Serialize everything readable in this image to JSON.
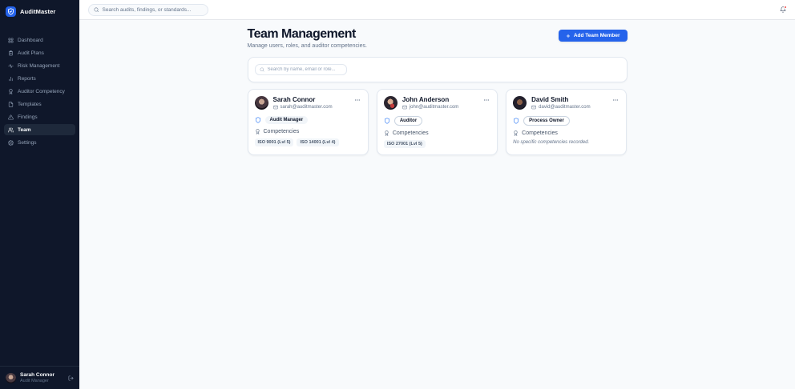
{
  "app": {
    "name": "AuditMaster"
  },
  "sidebar": {
    "items": [
      {
        "label": "Dashboard",
        "icon": "dashboard-icon",
        "active": false
      },
      {
        "label": "Audit Plans",
        "icon": "audit-plans-icon",
        "active": false
      },
      {
        "label": "Risk Management",
        "icon": "risk-management-icon",
        "active": false
      },
      {
        "label": "Reports",
        "icon": "reports-icon",
        "active": false
      },
      {
        "label": "Auditor Competency",
        "icon": "auditor-competency-icon",
        "active": false
      },
      {
        "label": "Templates",
        "icon": "templates-icon",
        "active": false
      },
      {
        "label": "Findings",
        "icon": "findings-icon",
        "active": false
      },
      {
        "label": "Team",
        "icon": "team-icon",
        "active": true
      },
      {
        "label": "Settings",
        "icon": "settings-icon",
        "active": false
      }
    ],
    "user": {
      "name": "Sarah Connor",
      "role": "Audit Manager"
    }
  },
  "topbar": {
    "search_placeholder": "Search audits, findings, or standards..."
  },
  "page": {
    "title": "Team Management",
    "subtitle": "Manage users, roles, and auditor competencies.",
    "add_button_label": "Add Team Member",
    "filter_placeholder": "Search by name, email or role...",
    "competencies_label": "Competencies",
    "no_competencies_text": "No specific competencies recorded."
  },
  "members": [
    {
      "name": "Sarah Connor",
      "email": "sarah@auditmaster.com",
      "role": "Audit Manager",
      "role_style": "filled",
      "competencies": [
        "ISO 9001 (Lvl 5)",
        "ISO 14001 (Lvl 4)"
      ]
    },
    {
      "name": "John Anderson",
      "email": "john@auditmaster.com",
      "role": "Auditor",
      "role_style": "outlined",
      "competencies": [
        "ISO 27001 (Lvl 5)"
      ]
    },
    {
      "name": "David Smith",
      "email": "david@auditmaster.com",
      "role": "Process Owner",
      "role_style": "outlined",
      "competencies": []
    }
  ],
  "colors": {
    "accent_blue": "#2563eb",
    "sidebar_bg": "#0f172a",
    "sidebar_active_bg": "#1e293b",
    "main_bg": "#f8fafc",
    "notification_dot": "#ef4444",
    "role_icon_blue": "#3b82f6"
  }
}
